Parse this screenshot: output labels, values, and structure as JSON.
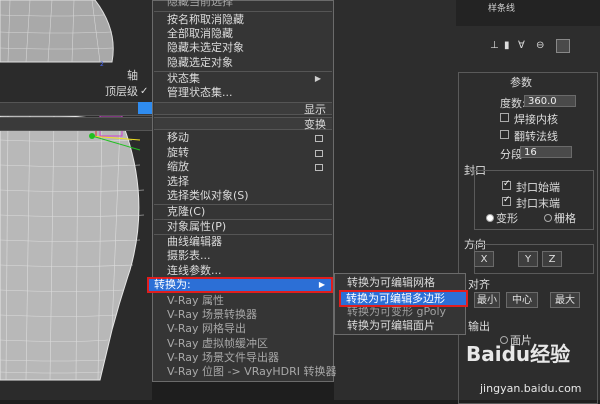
{
  "quad_left": {
    "axis": "轴",
    "top_level": "顶层级",
    "top_level_check": "✓",
    "display": "显示",
    "transform": "变换"
  },
  "context_menu": {
    "top_partial": "隐藏当前选择",
    "items_a": [
      "按名称取消隐藏",
      "全部取消隐藏",
      "隐藏未选定对象",
      "隐藏选定对象"
    ],
    "state_set": "状态集",
    "manage_state_set": "管理状态集...",
    "transform_items": [
      "移动",
      "旋转",
      "缩放",
      "选择",
      "选择类似对象(S)"
    ],
    "clone": "克隆(C)",
    "object_props": "对象属性(P)",
    "items_b": [
      "曲线编辑器",
      "摄影表...",
      "连线参数..."
    ],
    "convert_to": "转换为:",
    "vray_items": [
      "V-Ray 属性",
      "V-Ray 场景转换器",
      "V-Ray 网格导出",
      "V-Ray 虚拟帧缓冲区",
      "V-Ray 场景文件导出器",
      "V-Ray 位图 -> VRayHDRI 转换器"
    ]
  },
  "submenu": {
    "items": [
      "转换为可编辑网格",
      "转换为可编辑多边形",
      "转换为可变形 gPoly",
      "转换为可编辑面片"
    ]
  },
  "panel": {
    "object_name": "样条线",
    "params_title": "参数",
    "degrees_label": "度数:",
    "degrees_value": "360.0",
    "weld_core": "焊接内核",
    "flip_normals": "翻转法线",
    "segments_label": "分段:",
    "segments_value": "16",
    "cap_title": "封口",
    "cap_start": "封口始端",
    "cap_end": "封口末端",
    "morph": "变形",
    "grid": "栅格",
    "direction_title": "方向",
    "axis_buttons": [
      "X",
      "Y",
      "Z"
    ],
    "align_title": "对齐",
    "align_buttons": [
      "最小",
      "中心",
      "最大"
    ],
    "output_title": "输出",
    "output_patch": "面片"
  },
  "watermark": {
    "logo": "Baidu经验",
    "url": "jingyan.baidu.com"
  },
  "colors": {
    "highlight": "#2c6fd6",
    "annotation": "#e01e1e"
  }
}
